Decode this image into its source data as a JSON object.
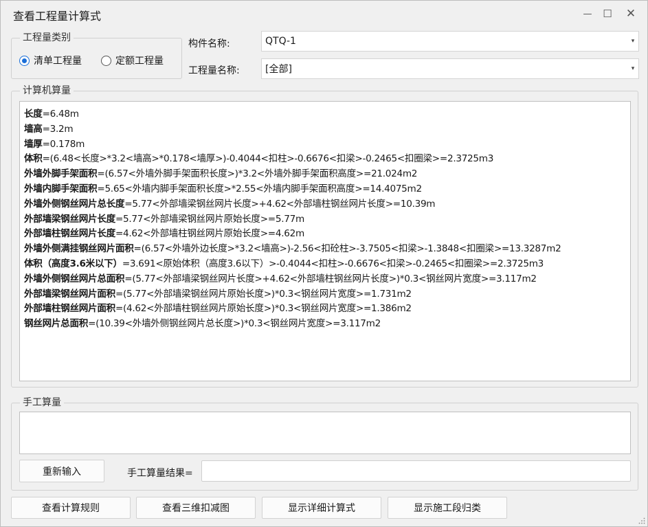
{
  "window": {
    "title": "查看工程量计算式",
    "controls": {
      "minimize": "—",
      "maximize": "☐",
      "close": "✕"
    }
  },
  "category": {
    "legend": "工程量类别",
    "options": [
      {
        "label": "清单工程量",
        "checked": true
      },
      {
        "label": "定额工程量",
        "checked": false
      }
    ]
  },
  "component": {
    "label": "构件名称:",
    "value": "QTQ-1"
  },
  "quantity": {
    "label": "工程量名称:",
    "value": "[全部]"
  },
  "computer": {
    "legend": "计算机算量",
    "lines": [
      {
        "name": "长度",
        "expr": "=6.48m"
      },
      {
        "name": "墙高",
        "expr": "=3.2m"
      },
      {
        "name": "墙厚",
        "expr": "=0.178m"
      },
      {
        "name": "体积",
        "expr": "=(6.48<长度>*3.2<墙高>*0.178<墙厚>)-0.4044<扣柱>-0.6676<扣梁>-0.2465<扣圈梁>=2.3725m3"
      },
      {
        "name": "外墙外脚手架面积",
        "expr": "=(6.57<外墙外脚手架面积长度>)*3.2<外墙外脚手架面积高度>=21.024m2"
      },
      {
        "name": "外墙内脚手架面积",
        "expr": "=5.65<外墙内脚手架面积长度>*2.55<外墙内脚手架面积高度>=14.4075m2"
      },
      {
        "name": "外墙外侧钢丝网片总长度",
        "expr": "=5.77<外部墙梁钢丝网片长度>+4.62<外部墙柱钢丝网片长度>=10.39m"
      },
      {
        "name": "外部墙梁钢丝网片长度",
        "expr": "=5.77<外部墙梁钢丝网片原始长度>=5.77m"
      },
      {
        "name": "外部墙柱钢丝网片长度",
        "expr": "=4.62<外部墙柱钢丝网片原始长度>=4.62m"
      },
      {
        "name": "外墙外侧满挂钢丝网片面积",
        "expr": "=(6.57<外墙外边长度>*3.2<墙高>)-2.56<扣砼柱>-3.7505<扣梁>-1.3848<扣圈梁>=13.3287m2"
      },
      {
        "name": "体积（高度3.6米以下）",
        "expr": "=3.691<原始体积（高度3.6以下）>-0.4044<扣柱>-0.6676<扣梁>-0.2465<扣圈梁>=2.3725m3"
      },
      {
        "name": "外墙外侧钢丝网片总面积",
        "expr": "=(5.77<外部墙梁钢丝网片长度>+4.62<外部墙柱钢丝网片长度>)*0.3<钢丝网片宽度>=3.117m2"
      },
      {
        "name": "外部墙梁钢丝网片面积",
        "expr": "=(5.77<外部墙梁钢丝网片原始长度>)*0.3<钢丝网片宽度>=1.731m2"
      },
      {
        "name": "外部墙柱钢丝网片面积",
        "expr": "=(4.62<外部墙柱钢丝网片原始长度>)*0.3<钢丝网片宽度>=1.386m2"
      },
      {
        "name": "钢丝网片总面积",
        "expr": "=(10.39<外墙外侧钢丝网片总长度>)*0.3<钢丝网片宽度>=3.117m2"
      }
    ]
  },
  "manual": {
    "legend": "手工算量",
    "text": "",
    "reenter_button": "重新输入",
    "result_label": "手工算量结果=",
    "result_value": ""
  },
  "footer_buttons": [
    "查看计算规则",
    "查看三维扣减图",
    "显示详细计算式",
    "显示施工段归类"
  ]
}
